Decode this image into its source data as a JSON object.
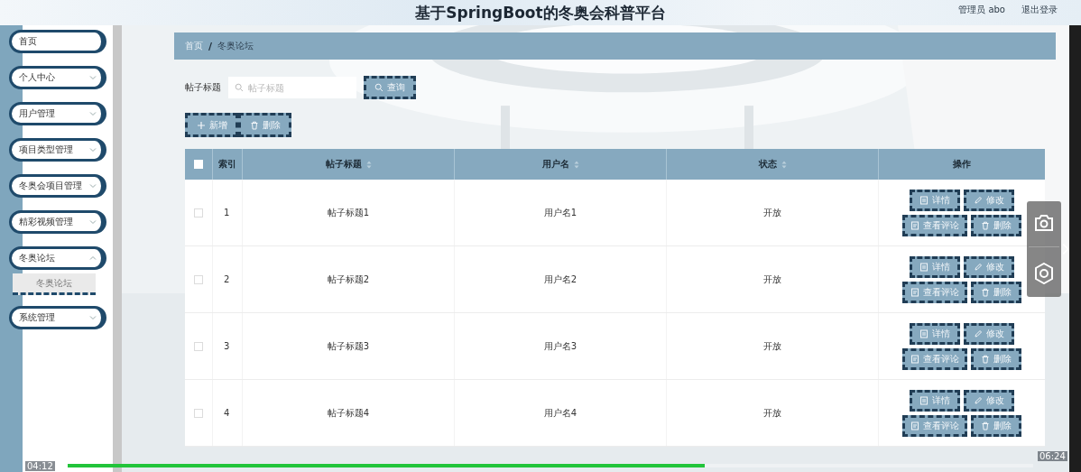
{
  "header": {
    "title": "基于SpringBoot的冬奥会科普平台",
    "user": "管理员 abo",
    "logout": "退出登录"
  },
  "sidebar": {
    "items": [
      {
        "label": "首页",
        "kind": "link"
      },
      {
        "label": "个人中心",
        "kind": "menu",
        "expanded": false
      },
      {
        "label": "用户管理",
        "kind": "menu",
        "expanded": false
      },
      {
        "label": "项目类型管理",
        "kind": "menu",
        "expanded": false
      },
      {
        "label": "冬奥会项目管理",
        "kind": "menu",
        "expanded": false
      },
      {
        "label": "精彩视频管理",
        "kind": "menu",
        "expanded": false
      },
      {
        "label": "冬奥论坛",
        "kind": "menu",
        "expanded": true,
        "children": [
          {
            "label": "冬奥论坛",
            "selected": true
          }
        ]
      },
      {
        "label": "系统管理",
        "kind": "menu",
        "expanded": false
      }
    ]
  },
  "breadcrumb": {
    "items": [
      "首页",
      "冬奥论坛"
    ],
    "separator": "/"
  },
  "search": {
    "label": "帖子标题",
    "placeholder": "帖子标题",
    "button": "查询"
  },
  "toolbar": [
    {
      "label": "新增",
      "kind": "add"
    },
    {
      "label": "删除",
      "kind": "delete"
    }
  ],
  "table": {
    "checked": false,
    "columns": [
      {
        "label": "索引",
        "kind": "text",
        "sortable": false
      },
      {
        "label": "帖子标题",
        "kind": "text",
        "sortable": true
      },
      {
        "label": "用户名",
        "kind": "text",
        "sortable": true
      },
      {
        "label": "状态",
        "kind": "text",
        "sortable": true
      },
      {
        "label": "操作",
        "kind": "actions",
        "sortable": false
      }
    ],
    "rows": [
      {
        "checked": false,
        "cells": [
          "1",
          "帖子标题1",
          "用户名1",
          "开放"
        ],
        "actions": [
          {
            "label": "详情",
            "kind": "detail"
          },
          {
            "label": "修改",
            "kind": "edit"
          },
          {
            "label": "查看评论",
            "kind": "comments"
          },
          {
            "label": "删除",
            "kind": "delete"
          }
        ]
      },
      {
        "checked": false,
        "cells": [
          "2",
          "帖子标题2",
          "用户名2",
          "开放"
        ],
        "actions": [
          {
            "label": "详情",
            "kind": "detail"
          },
          {
            "label": "修改",
            "kind": "edit"
          },
          {
            "label": "查看评论",
            "kind": "comments"
          },
          {
            "label": "删除",
            "kind": "delete"
          }
        ]
      },
      {
        "checked": false,
        "cells": [
          "3",
          "帖子标题3",
          "用户名3",
          "开放"
        ],
        "actions": [
          {
            "label": "详情",
            "kind": "detail"
          },
          {
            "label": "修改",
            "kind": "edit"
          },
          {
            "label": "查看评论",
            "kind": "comments"
          },
          {
            "label": "删除",
            "kind": "delete"
          }
        ]
      },
      {
        "checked": false,
        "cells": [
          "4",
          "帖子标题4",
          "用户名4",
          "开放"
        ],
        "actions": [
          {
            "label": "详情",
            "kind": "detail"
          },
          {
            "label": "修改",
            "kind": "edit"
          },
          {
            "label": "查看评论",
            "kind": "comments"
          },
          {
            "label": "删除",
            "kind": "delete"
          }
        ]
      }
    ]
  },
  "player": {
    "elapsed": "04:12",
    "duration": "06:24",
    "level": 0.66
  }
}
